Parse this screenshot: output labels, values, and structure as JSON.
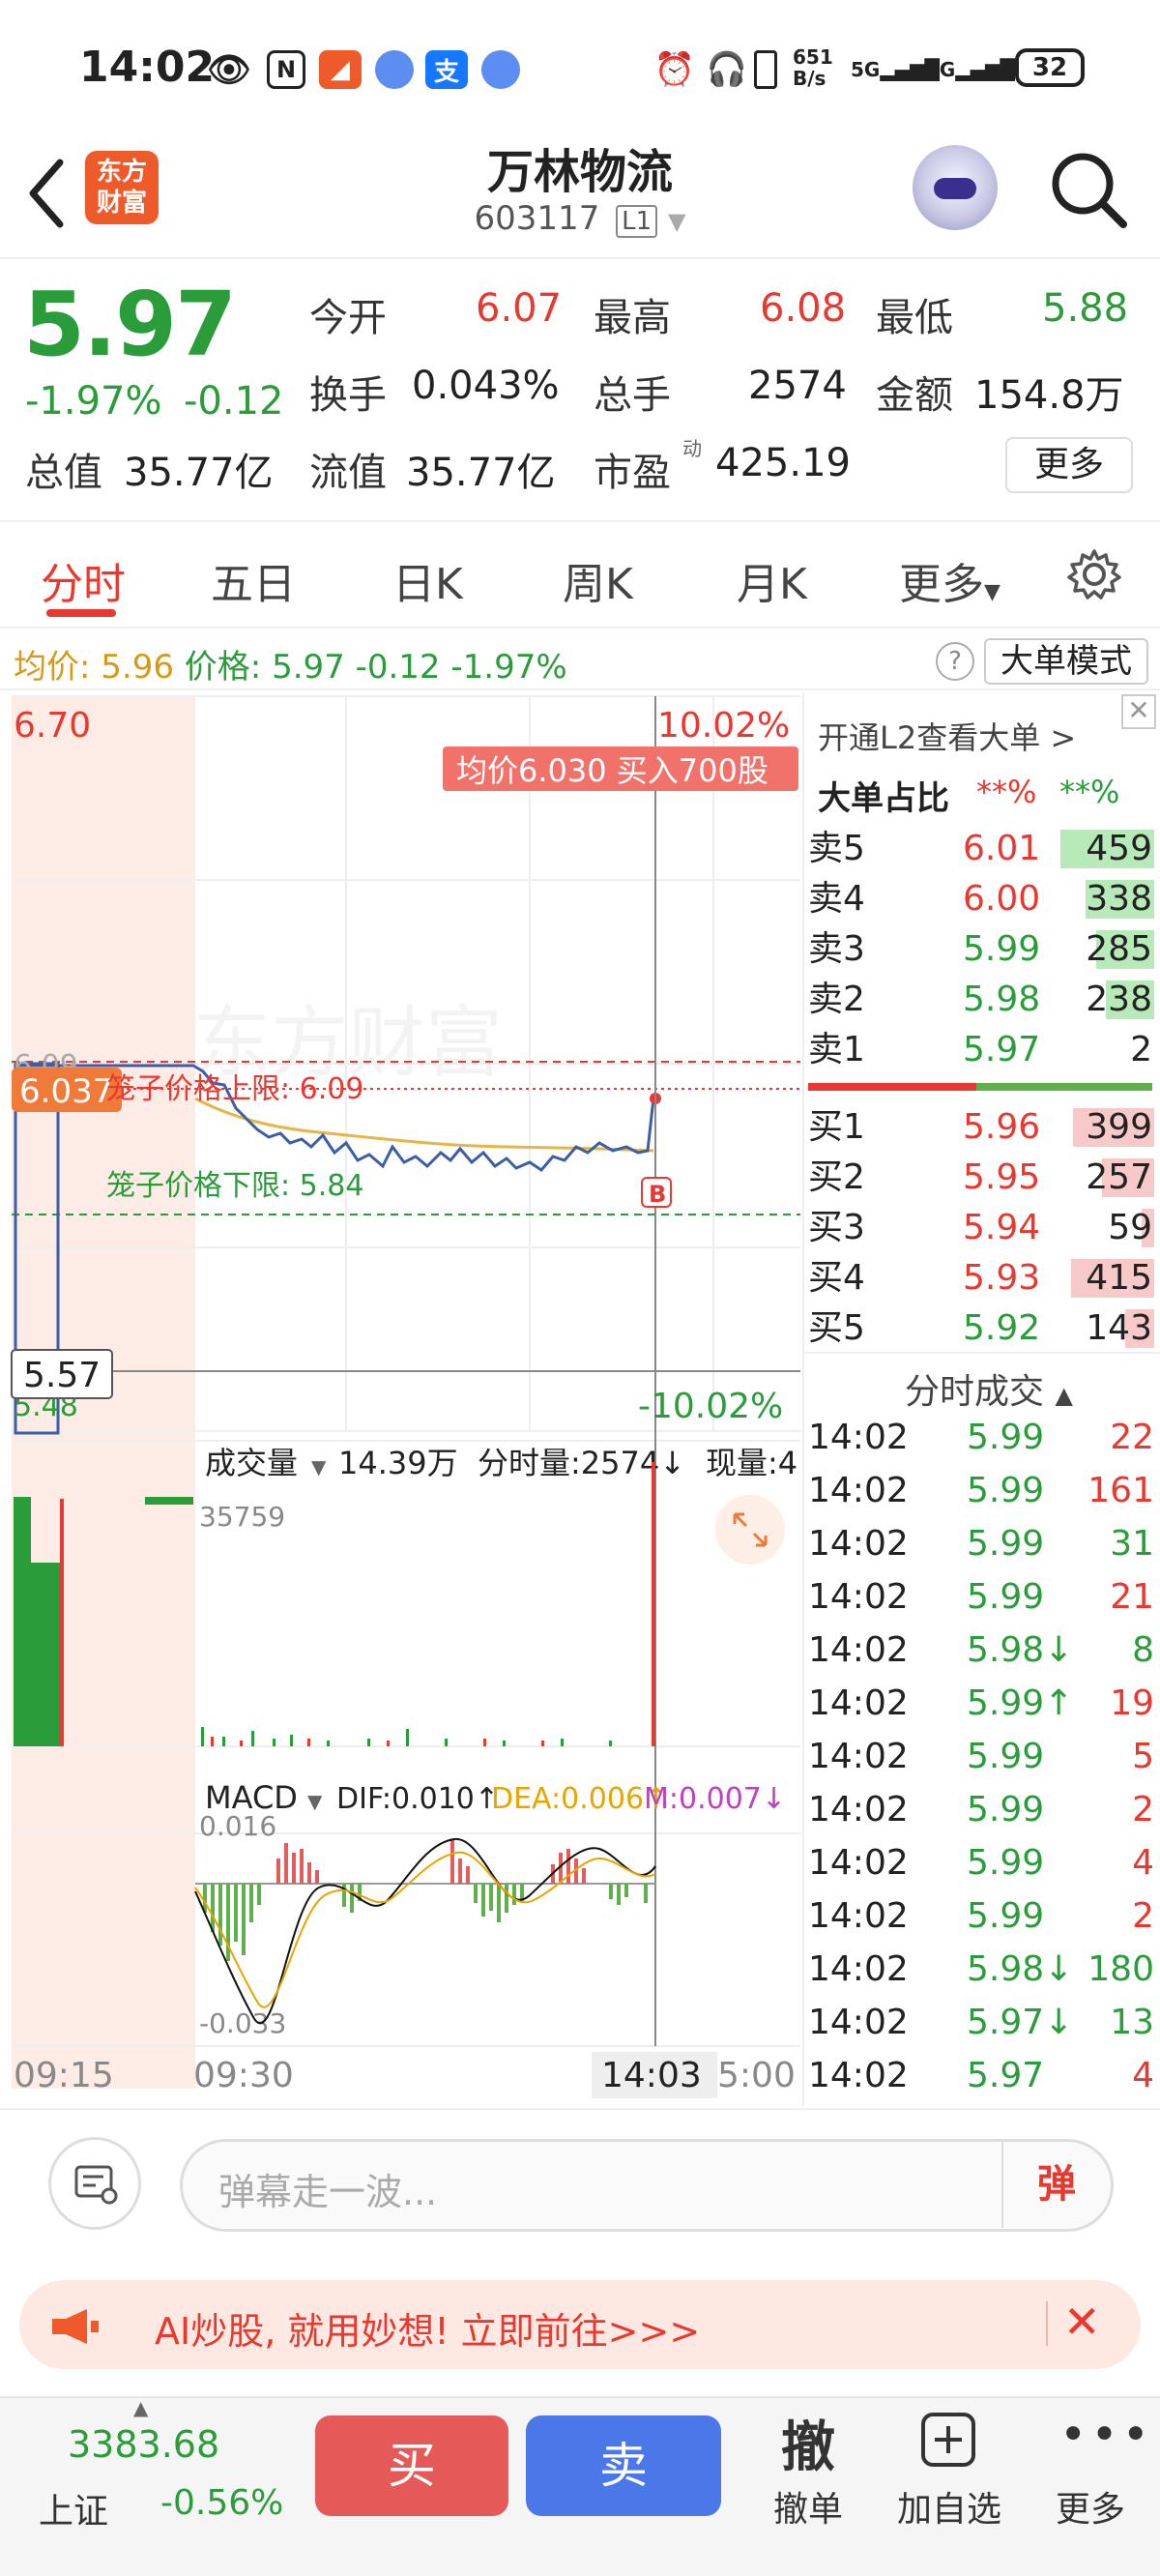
{
  "status_bar": {
    "time": "14:02",
    "net_speed": "651\nB/s",
    "battery": "32"
  },
  "header": {
    "title": "万林物流",
    "code": "603117",
    "level_badge": "L1",
    "logo_text": "东方\n财富"
  },
  "quote": {
    "price": "5.97",
    "change_pct": "-1.97%",
    "change": "-0.12",
    "open_label": "今开",
    "open": "6.07",
    "high_label": "最高",
    "high": "6.08",
    "low_label": "最低",
    "low": "5.88",
    "turnover_label": "换手",
    "turnover": "0.043%",
    "volume_label": "总手",
    "volume": "2574",
    "amount_label": "金额",
    "amount": "154.8万",
    "total_cap_label": "总值",
    "total_cap": "35.77亿",
    "float_cap_label": "流值",
    "float_cap": "35.77亿",
    "pe_label": "市盈",
    "pe_sup": "动",
    "pe": "425.19",
    "more_label": "更多"
  },
  "tabs": [
    "分时",
    "五日",
    "日K",
    "周K",
    "月K",
    "更多"
  ],
  "avg_bar": {
    "avg_label": "均价:",
    "avg": "5.96",
    "price_label": "价格:",
    "price": "5.97",
    "change": "-0.12",
    "pct": "-1.97%",
    "big_mode": "大单模式"
  },
  "chart": {
    "top_price": "6.70",
    "top_pct": "10.02%",
    "bottom_price": "5.48",
    "bottom_pct": "-10.02%",
    "cursor_price": "6.037",
    "cross_price": "5.57",
    "upper_label": "6.09",
    "tooltip": "均价6.030  买入700股",
    "cage_upper": "笼子价格上限: 6.09",
    "cage_lower": "笼子价格下限: 5.84",
    "watermark": "东方财富",
    "vol_header": {
      "label": "成交量",
      "total": "14.39万",
      "fenshi": "分时量:2574↓",
      "now": "现量:4"
    },
    "vol_max": "35759",
    "macd_header": {
      "label": "MACD",
      "dif": "DIF:0.010↑",
      "dea": "DEA:0.006↑",
      "m": "M:0.007↓"
    },
    "macd_top": "0.016",
    "macd_bottom": "-0.033",
    "time_labels": [
      "09:15",
      "09:30",
      "14:03",
      "5:00"
    ],
    "b_marker": "B"
  },
  "book": {
    "link": "开通L2查看大单 >",
    "ratio_label": "大单占比",
    "ratio_red": "**%",
    "ratio_green": "**%",
    "asks": [
      {
        "label": "卖5",
        "price": "6.01",
        "vol": "459",
        "fill": 0.9
      },
      {
        "label": "卖4",
        "price": "6.00",
        "vol": "338",
        "fill": 0.66
      },
      {
        "label": "卖3",
        "price": "5.99",
        "vol": "285",
        "fill": 0.56
      },
      {
        "label": "卖2",
        "price": "5.98",
        "vol": "238",
        "fill": 0.46
      },
      {
        "label": "卖1",
        "price": "5.97",
        "vol": "2",
        "fill": 0.0
      }
    ],
    "bids": [
      {
        "label": "买1",
        "price": "5.96",
        "vol": "399",
        "fill": 0.78
      },
      {
        "label": "买2",
        "price": "5.95",
        "vol": "257",
        "fill": 0.5
      },
      {
        "label": "买3",
        "price": "5.94",
        "vol": "59",
        "fill": 0.12
      },
      {
        "label": "买4",
        "price": "5.93",
        "vol": "415",
        "fill": 0.8
      },
      {
        "label": "买5",
        "price": "5.92",
        "vol": "143",
        "fill": 0.28
      }
    ],
    "trades_title": "分时成交",
    "trades": [
      {
        "t": "14:02",
        "p": "5.99",
        "v": "22",
        "pc": "green",
        "vc": "red"
      },
      {
        "t": "14:02",
        "p": "5.99",
        "v": "161",
        "pc": "green",
        "vc": "red"
      },
      {
        "t": "14:02",
        "p": "5.99",
        "v": "31",
        "pc": "green",
        "vc": "green"
      },
      {
        "t": "14:02",
        "p": "5.99",
        "v": "21",
        "pc": "green",
        "vc": "red"
      },
      {
        "t": "14:02",
        "p": "5.98↓",
        "v": "8",
        "pc": "green",
        "vc": "green"
      },
      {
        "t": "14:02",
        "p": "5.99↑",
        "v": "19",
        "pc": "green",
        "vc": "red"
      },
      {
        "t": "14:02",
        "p": "5.99",
        "v": "5",
        "pc": "green",
        "vc": "red"
      },
      {
        "t": "14:02",
        "p": "5.99",
        "v": "2",
        "pc": "green",
        "vc": "red"
      },
      {
        "t": "14:02",
        "p": "5.99",
        "v": "4",
        "pc": "green",
        "vc": "red"
      },
      {
        "t": "14:02",
        "p": "5.99",
        "v": "2",
        "pc": "green",
        "vc": "red"
      },
      {
        "t": "14:02",
        "p": "5.98↓",
        "v": "180",
        "pc": "green",
        "vc": "green"
      },
      {
        "t": "14:02",
        "p": "5.97↓",
        "v": "13",
        "pc": "green",
        "vc": "green"
      },
      {
        "t": "14:02",
        "p": "5.97",
        "v": "4",
        "pc": "green",
        "vc": "red"
      }
    ]
  },
  "danmu": {
    "placeholder": "弹幕走一波...",
    "send": "弹"
  },
  "ai_banner": {
    "text": "AI炒股, 就用妙想! 立即前往>>>"
  },
  "bottom": {
    "index_value": "3383.68",
    "index_name": "上证",
    "index_pct": "-0.56%",
    "buy": "买",
    "sell": "卖",
    "withdraw_icon": "撤",
    "withdraw": "撤单",
    "add_fav": "加自选",
    "more": "更多"
  },
  "colors": {
    "up": "#e8382f",
    "down": "#2a9d3a",
    "avg": "#d79a18",
    "price_line": "#3a5fa8",
    "accent": "#ef5a2a"
  }
}
